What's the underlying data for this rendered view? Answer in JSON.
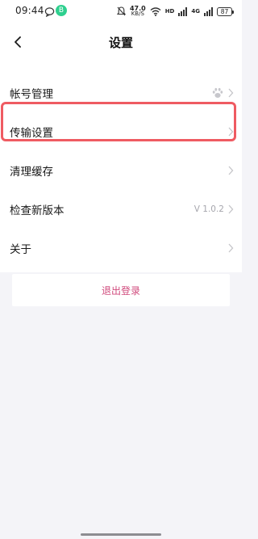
{
  "status_bar": {
    "time": "09:44",
    "app_badge": "B",
    "net_speed_value": "47.0",
    "net_speed_unit": "KB/S",
    "sim1": "HD",
    "sim2": "4G",
    "battery": "87"
  },
  "header": {
    "title": "设置"
  },
  "settings": {
    "items": [
      {
        "label": "帐号管理",
        "icon": "paw-icon"
      },
      {
        "label": "传输设置"
      },
      {
        "label": "清理缓存"
      },
      {
        "label": "检查新版本",
        "value": "V 1.0.2"
      },
      {
        "label": "关于"
      }
    ]
  },
  "logout": {
    "label": "退出登录"
  },
  "colors": {
    "highlight": "#ef5b62",
    "logout_text": "#d04a7c",
    "background": "#f4f4f8"
  }
}
